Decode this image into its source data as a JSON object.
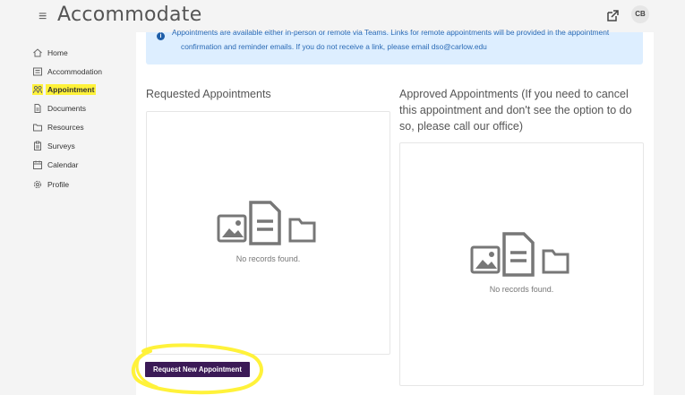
{
  "app": {
    "logo_text": "Accommodate",
    "avatar_initials": "CB"
  },
  "sidebar": {
    "items": [
      {
        "label": "Home",
        "icon": "home-icon"
      },
      {
        "label": "Accommodation",
        "icon": "list-icon"
      },
      {
        "label": "Appointment",
        "icon": "people-icon",
        "active": true
      },
      {
        "label": "Documents",
        "icon": "document-icon"
      },
      {
        "label": "Resources",
        "icon": "folder-icon"
      },
      {
        "label": "Surveys",
        "icon": "clipboard-icon"
      },
      {
        "label": "Calendar",
        "icon": "calendar-icon"
      },
      {
        "label": "Profile",
        "icon": "gear-icon"
      }
    ]
  },
  "banner": {
    "line1": "Appointments are available either in-person or remote via Teams. Links for remote appointments will be provided in the appointment",
    "line2": "confirmation and reminder emails. If you do not receive a link, please email dso@carlow.edu"
  },
  "requested": {
    "title": "Requested Appointments",
    "empty_text": "No records found."
  },
  "approved": {
    "title": "Approved Appointments (If you need to cancel this appointment and don't see the option to do so, please call our office)",
    "empty_text": "No records found."
  },
  "actions": {
    "request_label": "Request New Appointment"
  },
  "colors": {
    "accent": "#3b1a56",
    "highlight": "#fff23a",
    "banner_bg": "#ddeeff",
    "banner_text": "#2a6ab5"
  }
}
